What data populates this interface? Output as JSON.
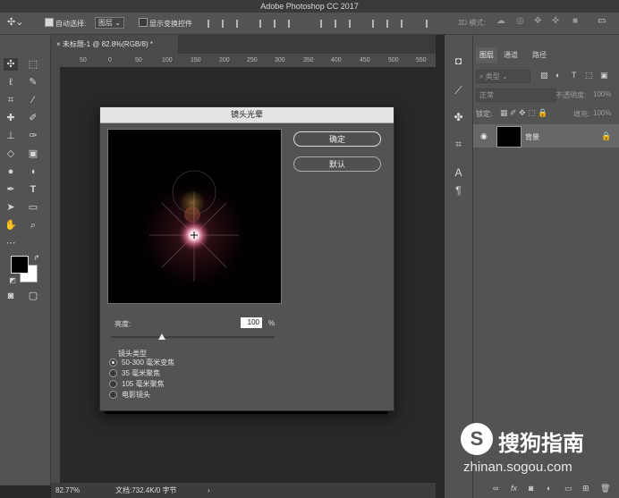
{
  "app": {
    "title": "Adobe Photoshop CC 2017"
  },
  "options_bar": {
    "auto_select_label": "自动选择:",
    "auto_select_value": "图层",
    "show_transform_label": "显示变换控件",
    "mode_3d_label": "3D 模式:"
  },
  "document": {
    "tab_title": "未标题-1 @ 82.8%(RGB/8) *",
    "ruler_ticks": [
      "50",
      "0",
      "50",
      "100",
      "150",
      "200",
      "250",
      "300",
      "350",
      "400",
      "450",
      "500",
      "550"
    ],
    "zoom": "82.77%",
    "doc_info": "文档:732.4K/0 字节"
  },
  "dialog": {
    "title": "镜头光晕",
    "ok_label": "确定",
    "default_label": "默认",
    "brightness_label": "亮度:",
    "brightness_value": "100",
    "brightness_unit": "%",
    "brightness_slider_value": 100,
    "lens_type_label": "镜头类型",
    "lens_options": [
      {
        "label": "50-300 毫米变焦",
        "selected": true
      },
      {
        "label": "35 毫米聚焦",
        "selected": false
      },
      {
        "label": "105 毫米聚焦",
        "selected": false
      },
      {
        "label": "电影镜头",
        "selected": false
      }
    ]
  },
  "layers_panel": {
    "tabs": [
      "图层",
      "通道",
      "路径"
    ],
    "filter_label": "类型",
    "blend_mode": "正常",
    "opacity_label": "不透明度:",
    "opacity_value": "100%",
    "lock_label": "锁定:",
    "fill_label": "填充:",
    "fill_value": "100%",
    "layer_name": "背景"
  },
  "watermark": {
    "brand": "搜狗指南",
    "url": "zhinan.sogou.com"
  },
  "colors": {
    "accent_flare": "#ffd6e6",
    "panel_bg": "#535353",
    "dialog_title_bg": "#e4e4e4"
  }
}
